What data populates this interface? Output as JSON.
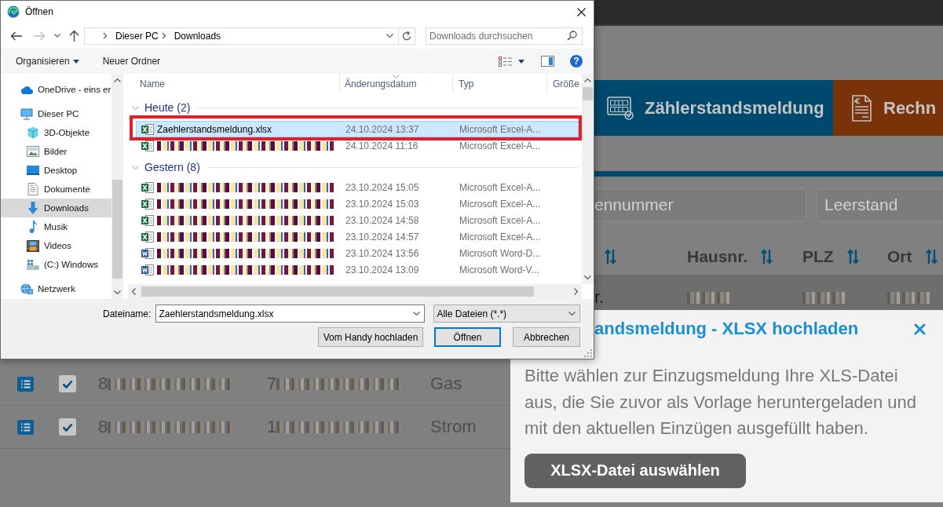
{
  "page": {
    "tiles": [
      {
        "label": "Zählerstandsmeldung",
        "kind": "meter",
        "color": "#00496e"
      },
      {
        "label": "Rechn",
        "kind": "invoice",
        "color": "#7a3309"
      }
    ],
    "filters": [
      {
        "placeholder": "ennummer"
      },
      {
        "placeholder": "Leerstand"
      }
    ],
    "table": {
      "header": [
        {
          "kind": "sort_only"
        },
        {
          "kind": "titled",
          "label": "Hausnr."
        },
        {
          "kind": "titled",
          "label": "PLZ"
        },
        {
          "kind": "titled",
          "label": "Ort"
        }
      ],
      "rows": [
        {
          "highlighted": true,
          "column_6": "r."
        },
        {
          "highlighted": false,
          "checked": true,
          "column_3": "8",
          "column_4": "7",
          "column_5": "Gas"
        },
        {
          "highlighted": false,
          "checked": true,
          "column_3": "8",
          "column_4": "1",
          "column_5": "Strom"
        }
      ]
    },
    "upload_panel": {
      "title": "andsmeldung - XLSX hochladen",
      "text": "Bitte wählen zur Einzugsmeldung Ihre XLS-Datei aus, die Sie zuvor als Vorlage heruntergeladen und mit den aktuellen Einzügen ausgefüllt haben.",
      "button": "XLSX-Datei auswählen"
    }
  },
  "dialog": {
    "title": "Öffnen",
    "breadcrumb": [
      "Dieser PC",
      "Downloads"
    ],
    "search": {
      "placeholder": "Downloads durchsuchen"
    },
    "toolbar": {
      "organize": "Organisieren",
      "new_folder": "Neuer Ordner",
      "help": "?"
    },
    "navigation": [
      {
        "label": "OneDrive - eins er",
        "kind": "cloud",
        "selected": false
      },
      {
        "label": "Dieser PC",
        "kind": "computer",
        "selected": false,
        "children": [
          {
            "label": "3D-Objekte",
            "kind": "cube",
            "selected": false
          },
          {
            "label": "Bilder",
            "kind": "pictures",
            "selected": false
          },
          {
            "label": "Desktop",
            "kind": "desktop",
            "selected": false
          },
          {
            "label": "Dokumente",
            "kind": "documents",
            "selected": false
          },
          {
            "label": "Downloads",
            "kind": "downloads",
            "selected": true
          },
          {
            "label": "Musik",
            "kind": "music",
            "selected": false
          },
          {
            "label": "Videos",
            "kind": "videos",
            "selected": false
          },
          {
            "label": "(C:) Windows",
            "kind": "drive",
            "selected": false
          }
        ]
      },
      {
        "label": "Netzwerk",
        "kind": "network",
        "selected": false
      }
    ],
    "columns": [
      {
        "label": "Name",
        "sorted": false
      },
      {
        "label": "Änderungsdatum",
        "sorted": true
      },
      {
        "label": "Typ",
        "sorted": false
      },
      {
        "label": "Größe",
        "sorted": false
      }
    ],
    "groups": [
      {
        "label": "Heute (2)",
        "expanded": true,
        "files": [
          {
            "name": "Zaehlerstandsmeldung.xlsx",
            "kind": "excel",
            "modified": "24.10.2024 13:37",
            "type": "Microsoft Excel-A...",
            "selected": true,
            "marked": true
          },
          {
            "kind": "excel",
            "modified": "24.10.2024 11:16",
            "type": "Microsoft Excel-A...",
            "selected": false,
            "marked": false
          }
        ]
      },
      {
        "label": "Gestern (8)",
        "expanded": true,
        "files": [
          {
            "kind": "excel",
            "modified": "23.10.2024 15:05",
            "type": "Microsoft Excel-A...",
            "selected": false,
            "marked": false
          },
          {
            "kind": "excel",
            "modified": "23.10.2024 15:03",
            "type": "Microsoft Excel-A...",
            "selected": false,
            "marked": false
          },
          {
            "kind": "excel",
            "modified": "23.10.2024 14:58",
            "type": "Microsoft Excel-A...",
            "selected": false,
            "marked": false
          },
          {
            "kind": "excel",
            "modified": "23.10.2024 14:57",
            "type": "Microsoft Excel-A...",
            "selected": false,
            "marked": false
          },
          {
            "kind": "word",
            "modified": "23.10.2024 13:56",
            "type": "Microsoft Word-D...",
            "selected": false,
            "marked": false
          },
          {
            "kind": "word",
            "modified": "23.10.2024 13:09",
            "type": "Microsoft Word-V...",
            "selected": false,
            "marked": false
          }
        ]
      }
    ],
    "file_name": {
      "label": "Dateiname:",
      "value": "Zaehlerstandsmeldung.xlsx"
    },
    "file_type": {
      "value": "Alle Dateien (*.*)"
    },
    "buttons": [
      {
        "label": "Vom Handy hochladen",
        "default": false
      },
      {
        "label": "Öffnen",
        "default": true
      },
      {
        "label": "Abbrechen",
        "default": false
      }
    ]
  }
}
